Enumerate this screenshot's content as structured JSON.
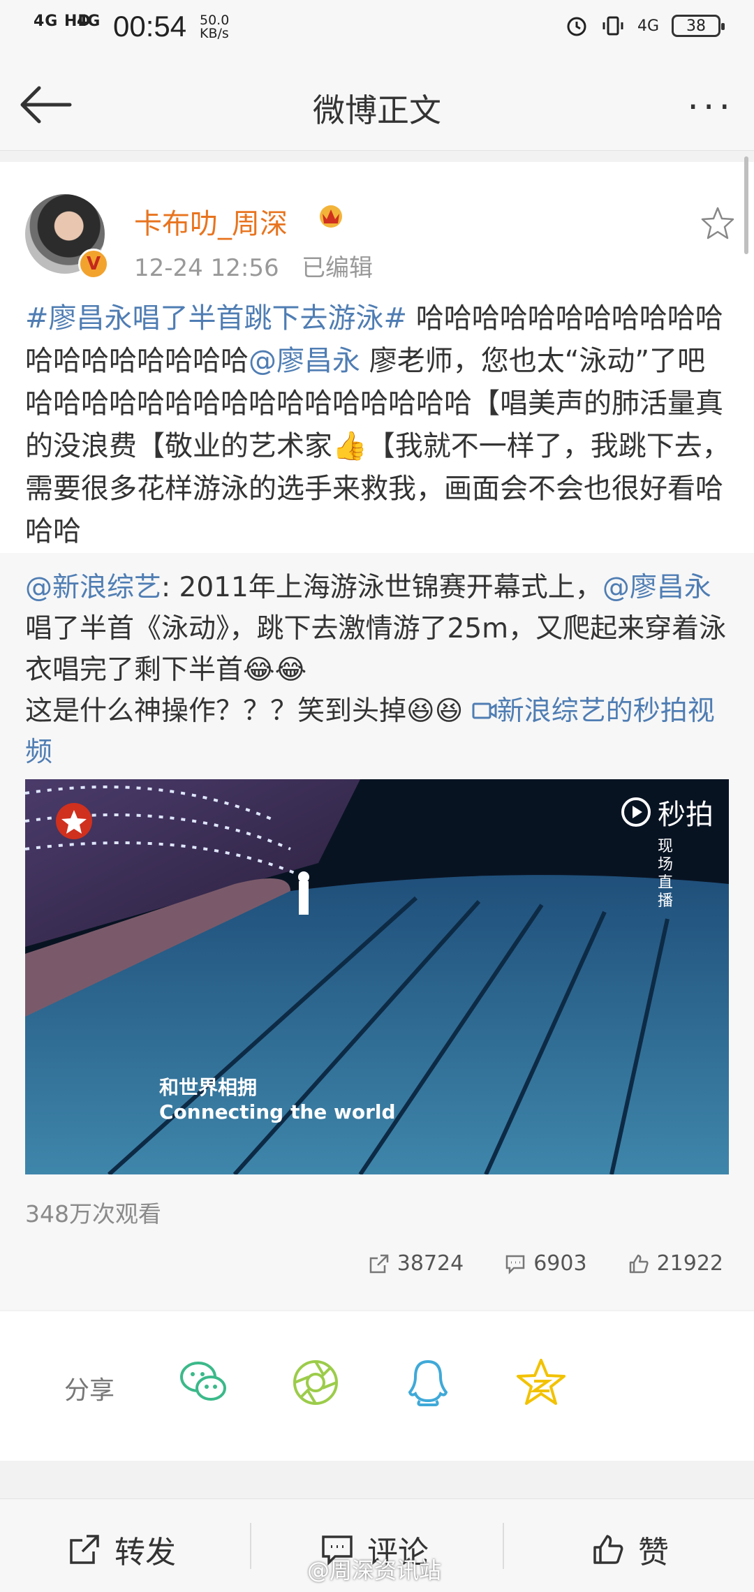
{
  "status_bar": {
    "signal1": "4G HD",
    "signal2": "4G",
    "time": "00:54",
    "speed_value": "50.0",
    "speed_unit": "KB/s",
    "network": "4G",
    "battery": "38"
  },
  "nav": {
    "title": "微博正文",
    "more": "···"
  },
  "post": {
    "username": "卡布叻_周深",
    "timestamp": "12-24 12:56",
    "edited": "已编辑",
    "hashtag": "#廖昌永唱了半首跳下去游泳#",
    "text_1": " 哈哈哈哈哈哈哈哈哈哈哈哈哈哈哈哈哈哈哈",
    "mention": "@廖昌永",
    "text_2": " 廖老师，您也太“泳动”了吧哈哈哈哈哈哈哈哈哈哈哈哈哈哈哈哈【唱美声的肺活量真的没浪费【敬业的艺术家👍【我就不一样了，我跳下去，需要很多花样游泳的选手来救我，画面会不会也很好看哈哈哈"
  },
  "retweet": {
    "mention_source": "@新浪综艺",
    "text_1": ": 2011年上海游泳世锦赛开幕式上，",
    "mention": "@廖昌永",
    "text_2": " 唱了半首《泳动》，跳下去激情游了25m，又爬起来穿着泳衣唱完了剩下半首😂😂",
    "text_3": "这是什么神操作？？？笑到头掉😆😆 ",
    "video_link": "新浪综艺的秒拍视频",
    "video": {
      "subtitle_cn": "和世界相拥",
      "subtitle_en": "Connecting the world",
      "logo": "秒拍",
      "live_label": "现场直播"
    },
    "views": "348万次观看",
    "reposts": "38724",
    "comments": "6903",
    "likes": "21922"
  },
  "share": {
    "label": "分享",
    "targets": [
      "wechat-icon",
      "moments-icon",
      "qq-icon",
      "qzone-icon"
    ]
  },
  "bottom_bar": {
    "repost": "转发",
    "comment": "评论",
    "like": "赞"
  },
  "watermark": "@周深资讯站",
  "colors": {
    "link": "#4f7db3",
    "username": "#e8741f"
  }
}
